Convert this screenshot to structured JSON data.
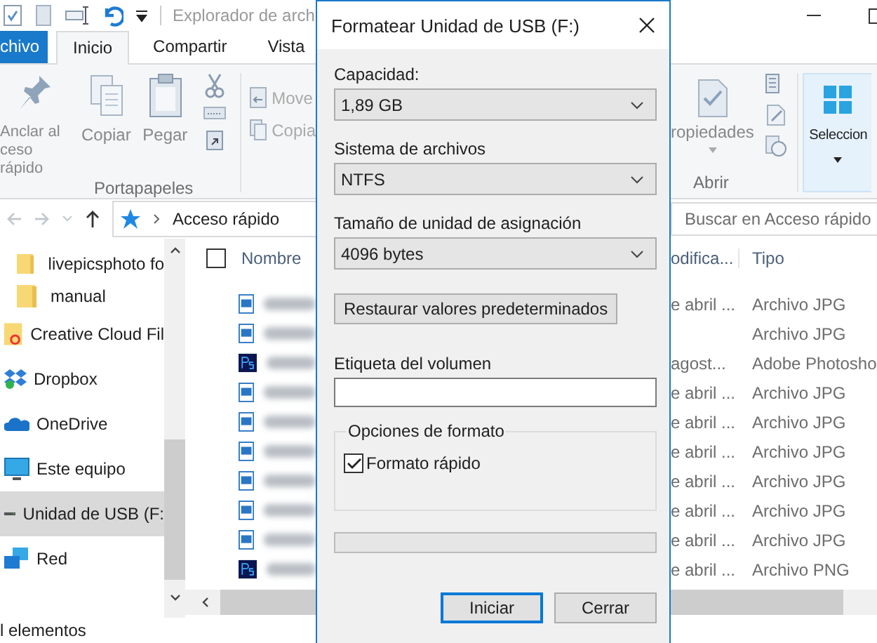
{
  "explorer": {
    "title": "Explorador de arch",
    "tabs": [
      {
        "label": "chivo",
        "kind": "file",
        "selected": false
      },
      {
        "label": "Inicio",
        "kind": "tab",
        "selected": true
      },
      {
        "label": "Compartir",
        "kind": "tab",
        "selected": false
      },
      {
        "label": "Vista",
        "kind": "tab",
        "selected": false
      }
    ],
    "ribbon": {
      "clipboard": [
        {
          "label": "Anclar al\nceso rápido",
          "kind": "pin"
        },
        {
          "label": "Copiar",
          "kind": "copy"
        },
        {
          "label": "Pegar",
          "kind": "paste"
        }
      ],
      "organize": [
        {
          "label": "Move",
          "kind": "move"
        },
        {
          "label": "Copia",
          "kind": "copyto"
        }
      ],
      "clipboard_group": "Portapapeles",
      "properties": "ropiedades",
      "open_group": "Abrir",
      "select": "Seleccion"
    },
    "address": {
      "path": "Acceso rápido",
      "search_placeholder": "Buscar en Acceso rápido"
    },
    "nav": [
      {
        "label": "livepicsphoto fo",
        "kind": "folder",
        "selected": false
      },
      {
        "label": "manual",
        "kind": "folder",
        "selected": false
      },
      {
        "label": "Creative Cloud Fil",
        "kind": "creative-cloud",
        "selected": false
      },
      {
        "label": "Dropbox",
        "kind": "dropbox",
        "selected": false
      },
      {
        "label": "OneDrive",
        "kind": "onedrive",
        "selected": false
      },
      {
        "label": "Este equipo",
        "kind": "pc",
        "selected": false
      },
      {
        "label": "Unidad de USB (F:",
        "kind": "usb",
        "selected": true
      },
      {
        "label": "Red",
        "kind": "network",
        "selected": false
      }
    ],
    "select_all_checked": false,
    "columns": {
      "name": "Nombre",
      "modified": "odifica...",
      "type": "Tipo"
    },
    "rows": [
      {
        "kind": "image",
        "date": "e abril ...",
        "type": "Archivo JPG"
      },
      {
        "kind": "image",
        "type": "Archivo JPG"
      },
      {
        "kind": "photoshop",
        "date": "agost...",
        "type": "Adobe Photosho"
      },
      {
        "kind": "image",
        "date": "e abril ...",
        "type": "Archivo JPG"
      },
      {
        "kind": "image",
        "date": "e abril ...",
        "type": "Archivo JPG"
      },
      {
        "kind": "image",
        "date": "e abril ...",
        "type": "Archivo JPG"
      },
      {
        "kind": "image",
        "date": "e abril ...",
        "type": "Archivo JPG"
      },
      {
        "kind": "image",
        "date": "e abril ...",
        "type": "Archivo JPG"
      },
      {
        "kind": "image",
        "date": "e abril ...",
        "type": "Archivo JPG"
      },
      {
        "kind": "photoshop",
        "date": "e abril ...",
        "type": "Archivo PNG"
      }
    ],
    "status": "l elementos"
  },
  "dialog": {
    "title": "Formatear Unidad de USB (F:)",
    "fields": [
      {
        "label": "Capacidad:",
        "value": "1,89 GB"
      },
      {
        "label": "Sistema de archivos",
        "value": "NTFS"
      },
      {
        "label": "Tamaño de unidad de asignación",
        "value": "4096 bytes"
      }
    ],
    "restore_button": "Restaurar valores predeterminados",
    "volume_label": {
      "label": "Etiqueta del volumen"
    },
    "format_options": {
      "title": "Opciones de formato",
      "quick_format": {
        "label": "Formato rápido",
        "checked": true
      }
    },
    "progress": {
      "level": 0
    },
    "buttons": [
      {
        "label": "Iniciar",
        "default": true
      },
      {
        "label": "Cerrar",
        "default": false
      }
    ]
  }
}
